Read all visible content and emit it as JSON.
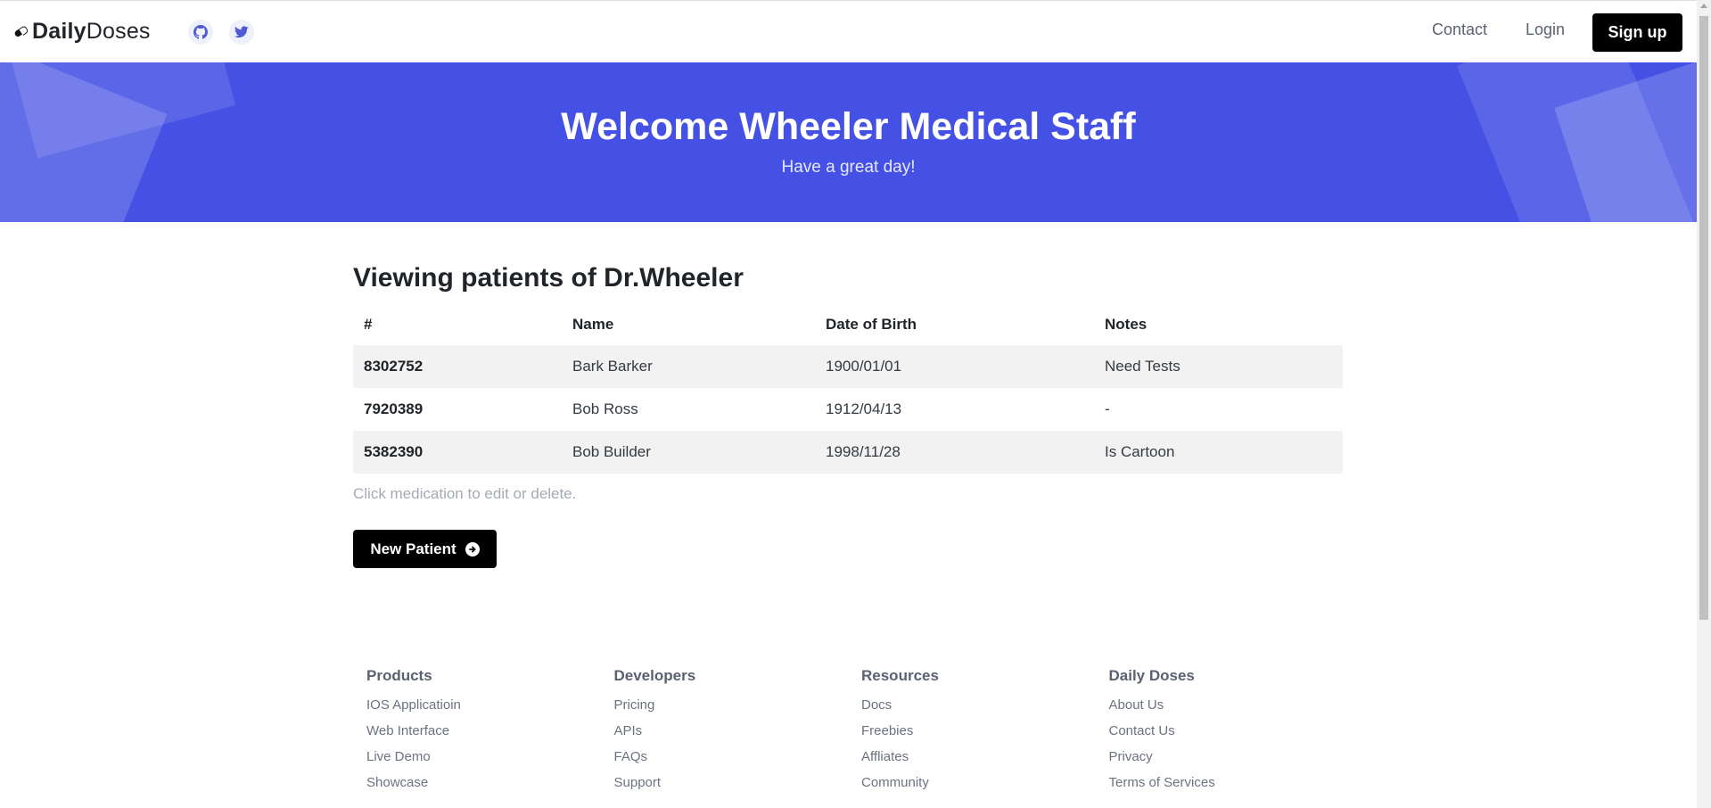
{
  "brand": {
    "bold": "Daily",
    "light": "Doses"
  },
  "nav": {
    "contact": "Contact",
    "login": "Login",
    "signup": "Sign up"
  },
  "hero": {
    "title": "Welcome Wheeler Medical Staff",
    "subtitle": "Have a great day!"
  },
  "main": {
    "title": "Viewing patients of Dr.Wheeler",
    "table": {
      "headers": [
        "#",
        "Name",
        "Date of Birth",
        "Notes"
      ],
      "rows": [
        {
          "id": "8302752",
          "name": "Bark Barker",
          "dob": "1900/01/01",
          "notes": "Need Tests"
        },
        {
          "id": "7920389",
          "name": "Bob Ross",
          "dob": "1912/04/13",
          "notes": "-"
        },
        {
          "id": "5382390",
          "name": "Bob Builder",
          "dob": "1998/11/28",
          "notes": "Is Cartoon"
        }
      ]
    },
    "hint": "Click medication to edit or delete.",
    "new_patient_label": "New Patient"
  },
  "footer": {
    "columns": [
      {
        "title": "Products",
        "links": [
          "IOS Applicatioin",
          "Web Interface",
          "Live Demo",
          "Showcase"
        ]
      },
      {
        "title": "Developers",
        "links": [
          "Pricing",
          "APIs",
          "FAQs",
          "Support"
        ]
      },
      {
        "title": "Resources",
        "links": [
          "Docs",
          "Freebies",
          "Affliates",
          "Community"
        ]
      },
      {
        "title": "Daily Doses",
        "links": [
          "About Us",
          "Contact Us",
          "Privacy",
          "Terms of Services"
        ]
      }
    ]
  },
  "colors": {
    "hero_bg": "#4451e4",
    "button_bg": "#000000",
    "social_icon": "#4f5bd5"
  },
  "icons": {
    "brand": "pill-icon",
    "github": "github-icon",
    "twitter": "twitter-icon",
    "new_patient": "arrow-circle-right-icon"
  }
}
